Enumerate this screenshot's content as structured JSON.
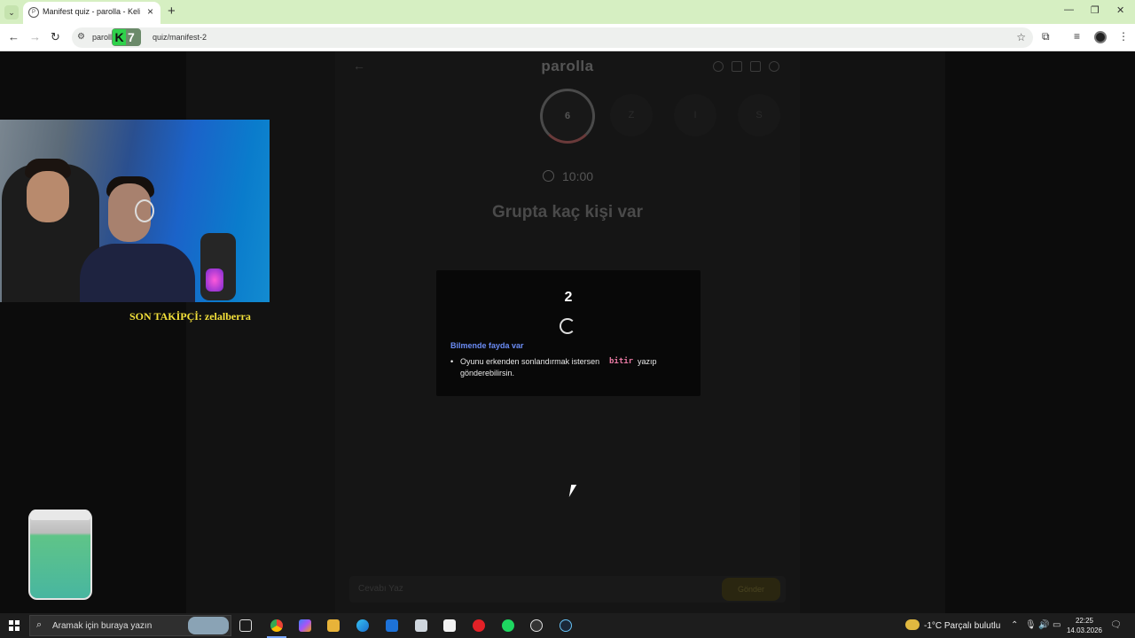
{
  "browser": {
    "tab_title": "Manifest quiz - parolla - Kelime",
    "url_prefix": "paroll",
    "url_suffix": "quiz/manifest-2",
    "logo_letter": "K",
    "logo_number": "7"
  },
  "app": {
    "logo": "parolla",
    "circle_letters": [
      "6",
      "Z",
      "I",
      "S"
    ],
    "timer": "10:00",
    "question": "Grupta kaç kişi var",
    "answer_placeholder": "Cevabı Yaz",
    "send_label": "Gönder"
  },
  "modal": {
    "countdown": "2",
    "tip_title": "Bilmende fayda var",
    "tip_text_before": "Oyunu erkenden sonlandırmak istersen",
    "tip_code": "bitir",
    "tip_text_after": "yazıp",
    "tip_text_line2": "gönderebilirsin."
  },
  "overlay": {
    "follower_text": "SON TAKİPÇİ: zelalberra"
  },
  "taskbar": {
    "search_placeholder": "Aramak için buraya yazın",
    "weather": "-1°C  Parçalı bulutlu",
    "time": "22:25",
    "date": "14.03.2026"
  },
  "colors": {
    "tab_bar": "#d6efc2",
    "tip_title": "#6b8cf5",
    "tip_code": "#e87aa3",
    "follower": "#f4e13a"
  }
}
